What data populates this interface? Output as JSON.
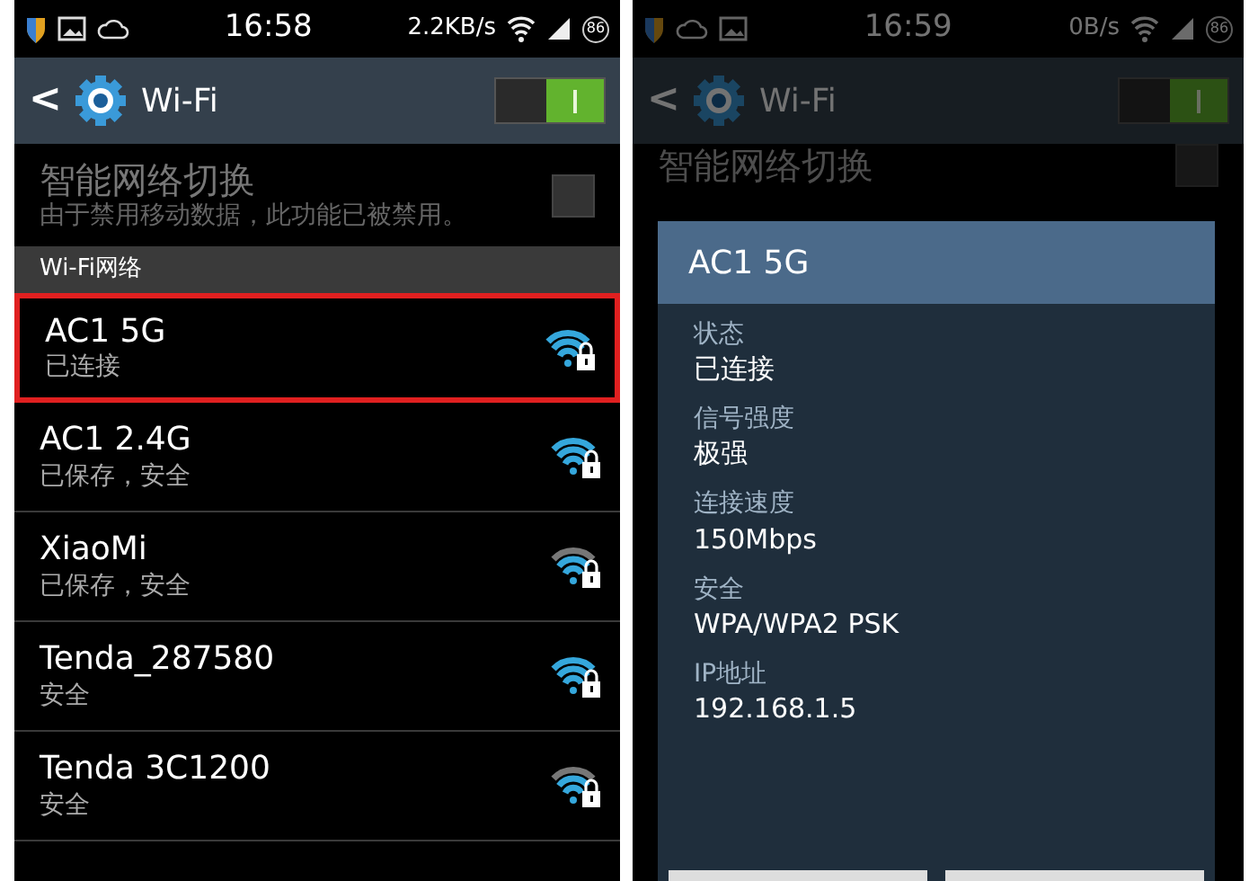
{
  "screens": [
    {
      "status_bar": {
        "icons": [
          {
            "kind": "shield"
          },
          {
            "kind": "image"
          },
          {
            "kind": "cloud"
          }
        ],
        "time": "16:58",
        "speed": "2.2KB/s",
        "battery": "86"
      },
      "action_bar": {
        "back": "<",
        "title": "Wi-Fi",
        "toggle_on": true
      },
      "smart_switch": {
        "title": "智能网络切换",
        "subtitle": "由于禁用移动数据，此功能已被禁用。",
        "checked": false
      },
      "section": "Wi-Fi网络",
      "networks": [
        {
          "name": "AC1 5G",
          "status": "已连接",
          "weak": false,
          "selected": true
        },
        {
          "name": "AC1 2.4G",
          "status": "已保存，安全",
          "weak": false,
          "selected": false
        },
        {
          "name": "XiaoMi",
          "status": "已保存，安全",
          "weak": true,
          "selected": false
        },
        {
          "name": "Tenda_287580",
          "status": "安全",
          "weak": false,
          "selected": false
        },
        {
          "name": "Tenda 3C1200",
          "status": "安全",
          "weak": true,
          "selected": false
        }
      ]
    },
    {
      "status_bar": {
        "icons": [
          {
            "kind": "shield"
          },
          {
            "kind": "cloud"
          },
          {
            "kind": "image"
          }
        ],
        "time": "16:59",
        "speed": "0B/s",
        "battery": "86"
      },
      "action_bar": {
        "back": "<",
        "title": "Wi-Fi",
        "toggle_on": true
      },
      "smart_switch": {
        "title": "智能网络切换",
        "checked": false
      },
      "dialog": {
        "title": "AC1 5G",
        "fields": [
          {
            "label": "状态",
            "value": "已连接"
          },
          {
            "label": "信号强度",
            "value": "极强"
          },
          {
            "label": "连接速度",
            "value": "150Mbps"
          },
          {
            "label": "安全",
            "value": "WPA/WPA2 PSK"
          },
          {
            "label": "IP地址",
            "value": "192.168.1.5"
          }
        ]
      }
    }
  ]
}
